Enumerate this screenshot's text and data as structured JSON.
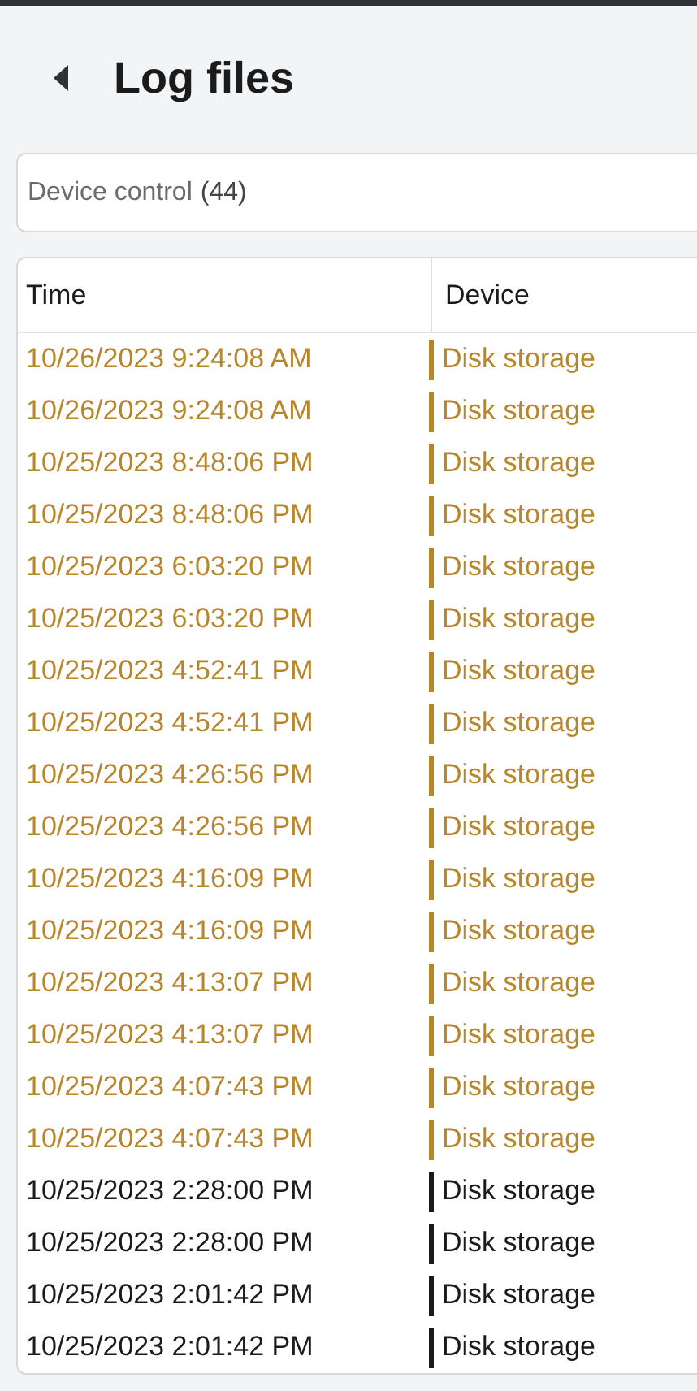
{
  "page": {
    "title": "Log files"
  },
  "filter": {
    "label": "Device control",
    "count": "(44)"
  },
  "table": {
    "columns": [
      "Time",
      "Device"
    ],
    "rows": [
      {
        "time": "10/26/2023 9:24:08 AM",
        "device": "Disk storage",
        "color": "#b8862a"
      },
      {
        "time": "10/26/2023 9:24:08 AM",
        "device": "Disk storage",
        "color": "#b8862a"
      },
      {
        "time": "10/25/2023 8:48:06 PM",
        "device": "Disk storage",
        "color": "#b8862a"
      },
      {
        "time": "10/25/2023 8:48:06 PM",
        "device": "Disk storage",
        "color": "#b8862a"
      },
      {
        "time": "10/25/2023 6:03:20 PM",
        "device": "Disk storage",
        "color": "#b8862a"
      },
      {
        "time": "10/25/2023 6:03:20 PM",
        "device": "Disk storage",
        "color": "#b8862a"
      },
      {
        "time": "10/25/2023 4:52:41 PM",
        "device": "Disk storage",
        "color": "#b8862a"
      },
      {
        "time": "10/25/2023 4:52:41 PM",
        "device": "Disk storage",
        "color": "#b8862a"
      },
      {
        "time": "10/25/2023 4:26:56 PM",
        "device": "Disk storage",
        "color": "#b8862a"
      },
      {
        "time": "10/25/2023 4:26:56 PM",
        "device": "Disk storage",
        "color": "#b8862a"
      },
      {
        "time": "10/25/2023 4:16:09 PM",
        "device": "Disk storage",
        "color": "#b8862a"
      },
      {
        "time": "10/25/2023 4:16:09 PM",
        "device": "Disk storage",
        "color": "#b8862a"
      },
      {
        "time": "10/25/2023 4:13:07 PM",
        "device": "Disk storage",
        "color": "#b8862a"
      },
      {
        "time": "10/25/2023 4:13:07 PM",
        "device": "Disk storage",
        "color": "#b8862a"
      },
      {
        "time": "10/25/2023 4:07:43 PM",
        "device": "Disk storage",
        "color": "#b8862a"
      },
      {
        "time": "10/25/2023 4:07:43 PM",
        "device": "Disk storage",
        "color": "#b8862a"
      },
      {
        "time": "10/25/2023 2:28:00 PM",
        "device": "Disk storage",
        "color": "#1a1a1a"
      },
      {
        "time": "10/25/2023 2:28:00 PM",
        "device": "Disk storage",
        "color": "#1a1a1a"
      },
      {
        "time": "10/25/2023 2:01:42 PM",
        "device": "Disk storage",
        "color": "#1a1a1a"
      },
      {
        "time": "10/25/2023 2:01:42 PM",
        "device": "Disk storage",
        "color": "#1a1a1a"
      }
    ]
  }
}
